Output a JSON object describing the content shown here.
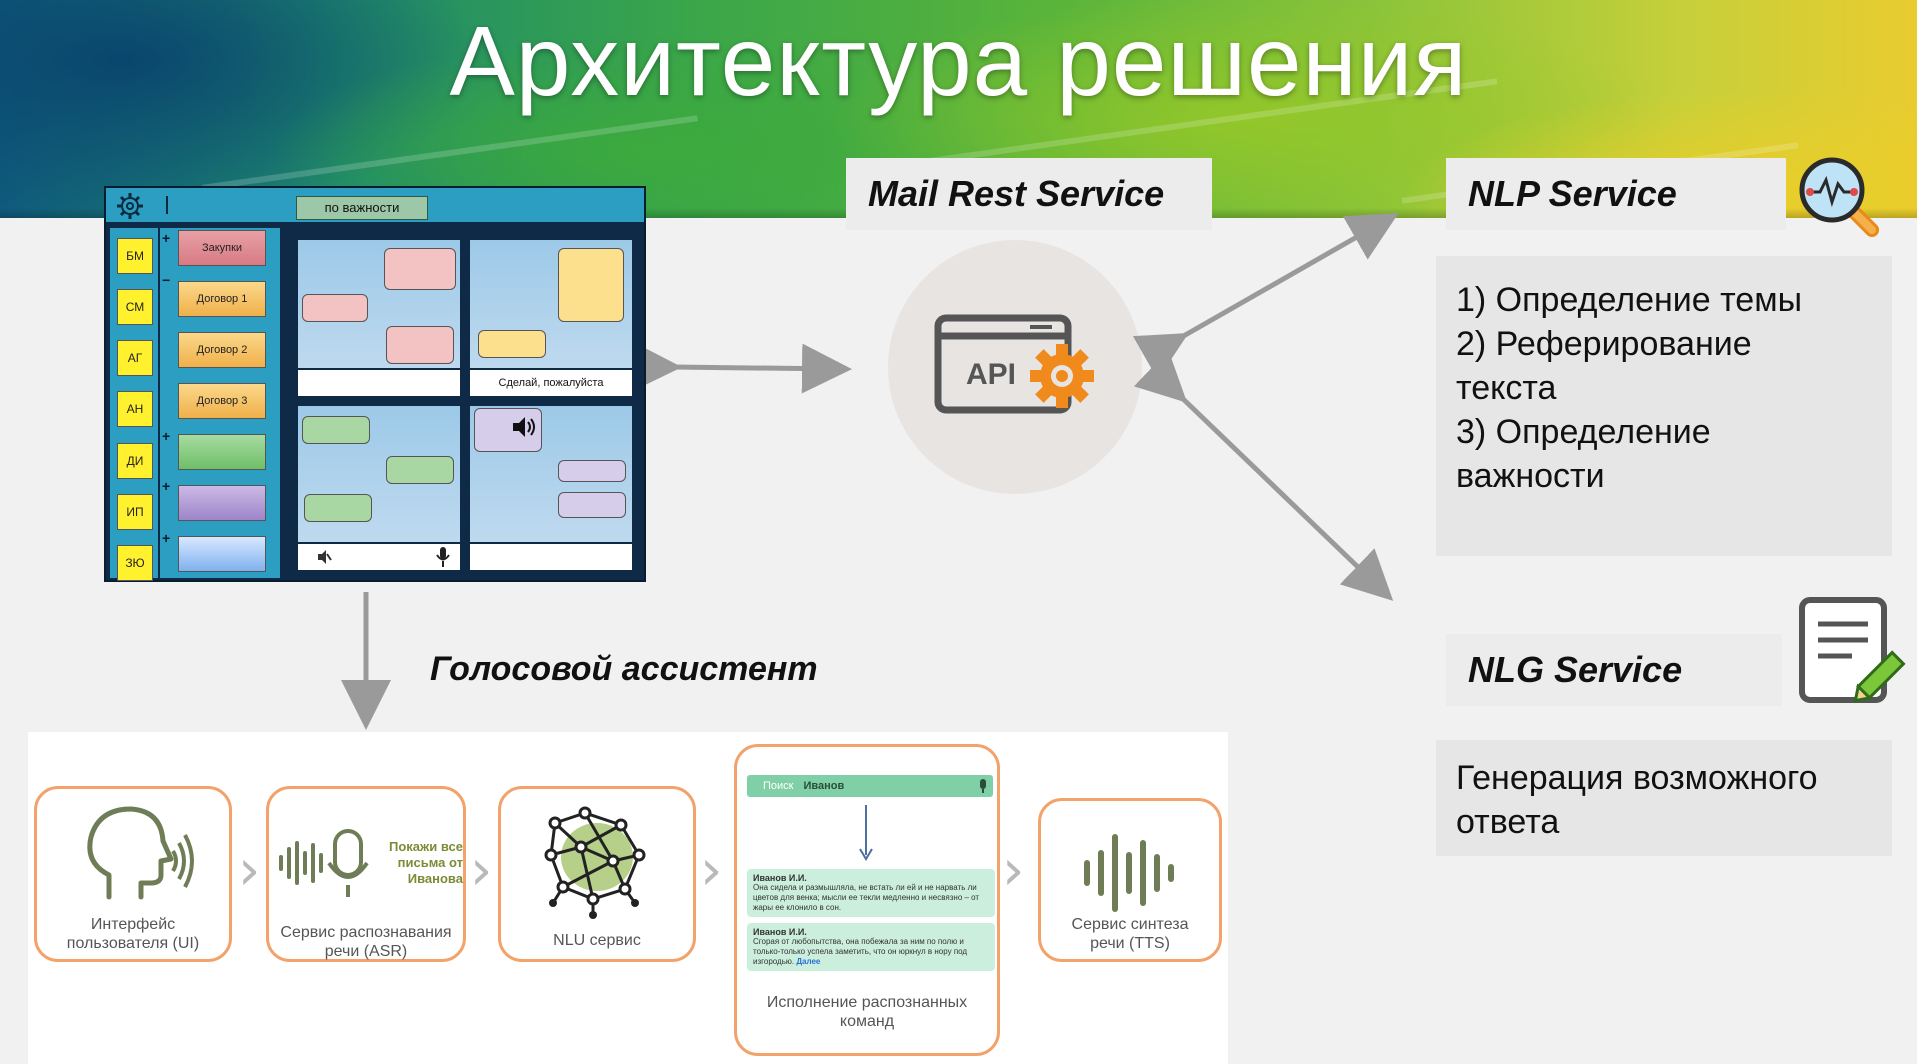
{
  "title": "Архитектура решения",
  "mail_rest_service": {
    "label": "Mail Rest Service",
    "badge": "API"
  },
  "nlp_service": {
    "label": "NLP Service",
    "items": [
      "1) Определение темы",
      "2) Реферирование",
      "текста",
      "3) Определение",
      "важности"
    ]
  },
  "nlg_service": {
    "label": "NLG Service",
    "items": [
      "Генерация возможного",
      "ответа"
    ]
  },
  "mail_app": {
    "sort_button": "по важности",
    "users": [
      "БМ",
      "СМ",
      "АГ",
      "АН",
      "ДИ",
      "ИП",
      "ЗЮ"
    ],
    "folders": [
      "Закупки",
      "Договор 1",
      "Договор 2",
      "Договор 3",
      "",
      "",
      ""
    ],
    "folder_colors": [
      "#e58f96",
      "#f6c66a",
      "#f6c66a",
      "#f6c66a",
      "#8fcf8a",
      "#b9a2d6",
      "#a9c9f2"
    ],
    "panel_caption": "Сделай, пожалуйста"
  },
  "voice_assistant": {
    "title": "Голосовой ассистент",
    "steps": [
      {
        "caption": [
          "Интерфейс",
          "пользователя (UI)"
        ]
      },
      {
        "caption": [
          "Сервис распознавания",
          "речи (ASR)"
        ],
        "speech": [
          "Покажи все",
          "письма от",
          "Иванова"
        ]
      },
      {
        "caption": [
          "NLU сервис"
        ]
      },
      {
        "caption": [
          "Исполнение распознанных",
          "команд"
        ],
        "search_placeholder": "Поиск",
        "search_value": "Иванов",
        "mails": [
          {
            "sender": "Иванов И.И.",
            "text": "Она сидела и размышляла, не встать ли ей и не нарвать ли цветов для венка; мысли ее текли медленно и несвязно – от жары ее клонило в сон."
          },
          {
            "sender": "Иванов И.И.",
            "text": "Сгорая от любопытства, она побежала за ним по полю и только-только успела заметить, что он юркнул в нору под изгородью.",
            "more": "Далее"
          }
        ]
      },
      {
        "caption": [
          "Сервис синтеза",
          "речи (TTS)"
        ]
      }
    ]
  },
  "colors": {
    "accent_orange": "#f2a26a",
    "icon_green": "#6f7d57",
    "gear_orange": "#f08a1c",
    "arrow_gray": "#9a9a9a"
  }
}
